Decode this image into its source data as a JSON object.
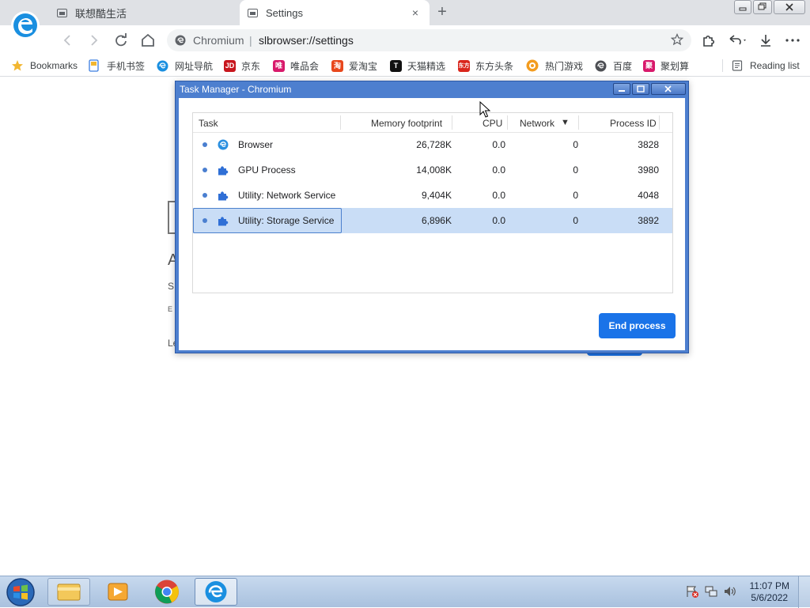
{
  "browser": {
    "tabs": [
      {
        "title": "联想酷生活",
        "active": false
      },
      {
        "title": "Settings",
        "active": true
      }
    ],
    "new_tab": "+",
    "close_tab": "×",
    "omnibox": {
      "origin": "Chromium",
      "separator": "|",
      "url": "slbrowser://settings"
    },
    "bookmarks": [
      {
        "label": "Bookmarks",
        "icon": "star-icon"
      },
      {
        "label": "手机书签",
        "icon": "phone-icon"
      },
      {
        "label": "网址导航",
        "icon": "browser-e-icon"
      },
      {
        "label": "京东",
        "icon": "jd-icon"
      },
      {
        "label": "唯品会",
        "icon": "vip-icon"
      },
      {
        "label": "爱淘宝",
        "icon": "taobao-icon"
      },
      {
        "label": "天猫精选",
        "icon": "tmall-icon"
      },
      {
        "label": "东方头条",
        "icon": "eastday-icon"
      },
      {
        "label": "热门游戏",
        "icon": "games-icon"
      },
      {
        "label": "百度",
        "icon": "baidu-icon"
      },
      {
        "label": "聚划算",
        "icon": "juhuasuan-icon"
      }
    ],
    "reading_list": "Reading list",
    "bookmark_icon_text": {
      "jd": "JD",
      "vip": "唯",
      "taobao": "淘",
      "tmall": "T",
      "eastday": "东方",
      "juhuasuan": "聚"
    },
    "colors": {
      "accent": "#1a73e8"
    }
  },
  "background_page": {
    "t1": "A",
    "t2": "S",
    "t3": "E",
    "t4": "Le"
  },
  "task_manager": {
    "title": "Task Manager - Chromium",
    "columns": {
      "task": "Task",
      "memory": "Memory footprint",
      "cpu": "CPU",
      "network": "Network",
      "sort_indicator": "▼",
      "pid": "Process ID"
    },
    "rows": [
      {
        "task": "Browser",
        "icon": "browser-e-icon",
        "memory": "26,728K",
        "cpu": "0.0",
        "network": "0",
        "pid": "3828",
        "selected": false
      },
      {
        "task": "GPU Process",
        "icon": "puzzle-icon",
        "memory": "14,008K",
        "cpu": "0.0",
        "network": "0",
        "pid": "3980",
        "selected": false
      },
      {
        "task": "Utility: Network Service",
        "icon": "puzzle-icon",
        "memory": "9,404K",
        "cpu": "0.0",
        "network": "0",
        "pid": "4048",
        "selected": false
      },
      {
        "task": "Utility: Storage Service",
        "icon": "puzzle-icon",
        "memory": "6,896K",
        "cpu": "0.0",
        "network": "0",
        "pid": "3892",
        "selected": true
      }
    ],
    "end_process": "End process"
  },
  "taskbar": {
    "items": [
      "file-explorer-icon",
      "media-player-icon",
      "chrome-icon",
      "browser-e-icon"
    ],
    "clock": {
      "time": "11:07 PM",
      "date": "5/6/2022"
    }
  }
}
